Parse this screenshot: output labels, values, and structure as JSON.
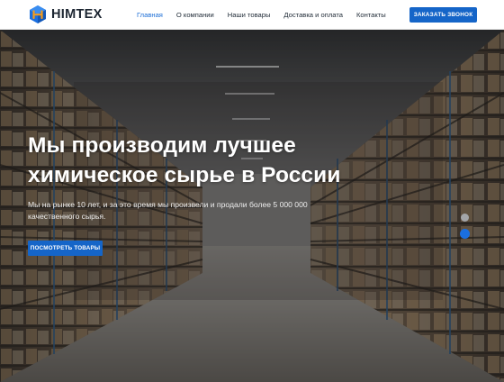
{
  "header": {
    "logo_text": "HIMTEX",
    "nav": [
      {
        "label": "Главная",
        "active": true
      },
      {
        "label": "О компании",
        "active": false
      },
      {
        "label": "Наши товары",
        "active": false
      },
      {
        "label": "Доставка и оплата",
        "active": false
      },
      {
        "label": "Контакты",
        "active": false
      }
    ],
    "cta_label": "ЗАКАЗАТЬ ЗВОНОК"
  },
  "hero": {
    "title_line1": "Мы производим лучшее",
    "title_line2": "химическое сырье в России",
    "subtitle_line1": "Мы на рынке 10 лет, и за это время мы произвели и продали более 5 000 000",
    "subtitle_line2": "качественного сырья.",
    "button_label": "ПОСМОТРЕТЬ ТОВАРЫ",
    "slides": [
      {
        "active": false
      },
      {
        "active": true
      }
    ]
  },
  "colors": {
    "accent": "#1565c8",
    "nav_active": "#1e6fd6",
    "text_dark": "#1f2a36",
    "logo_orange": "#f39c1f",
    "logo_blue": "#1a6fe0"
  }
}
